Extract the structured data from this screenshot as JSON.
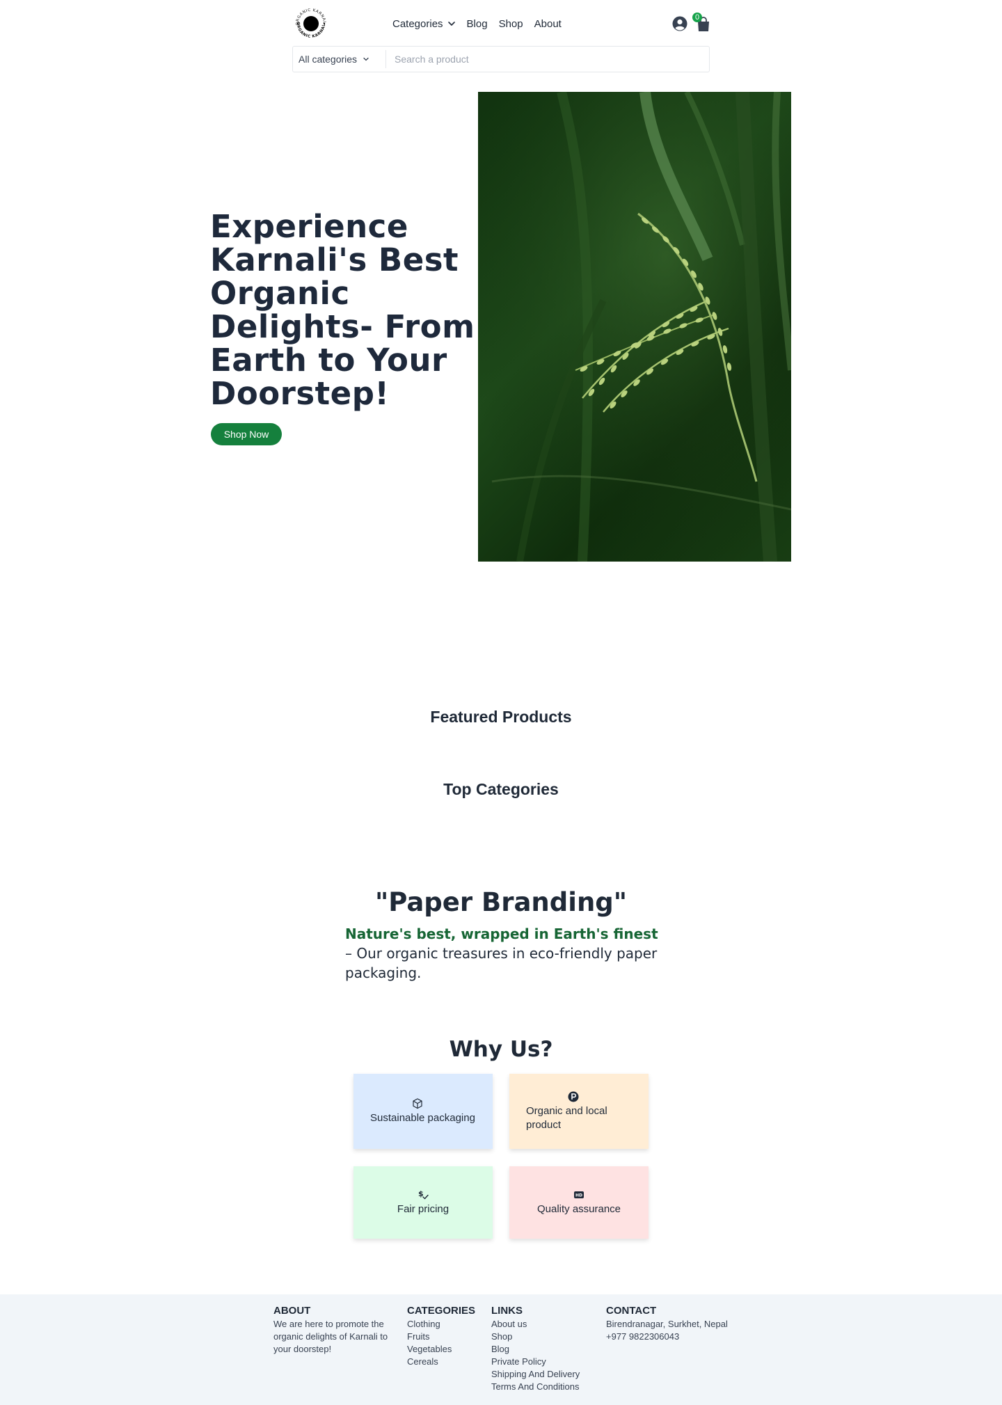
{
  "header": {
    "logo_top_text": "ORGANIC KARNALI",
    "logo_bottom_text": "ORGANIC KARNALI",
    "nav": {
      "categories": "Categories",
      "blog": "Blog",
      "shop": "Shop",
      "about": "About"
    },
    "cart_count": "0"
  },
  "search": {
    "category_label": "All categories",
    "placeholder": "Search a product",
    "value": ""
  },
  "hero": {
    "title": "Experience Karnali's Best Organic Delights- From Earth to Your Doorstep!",
    "button": "Shop Now",
    "image": "rice-plant-photo"
  },
  "sections": {
    "featured": "Featured Products",
    "top_categories": "Top Categories"
  },
  "paper": {
    "title": "\"Paper Branding\"",
    "highlight": "Nature's best, wrapped in Earth's finest",
    "text": " – Our organic treasures in eco-friendly paper packaging."
  },
  "why": {
    "title": "Why Us?",
    "cards": [
      {
        "label": "Sustainable packaging",
        "icon": "cube-icon",
        "color": "#dbeafe"
      },
      {
        "label": "Organic and local product",
        "icon": "product-badge-icon",
        "color": "#ffedd5"
      },
      {
        "label": "Fair pricing",
        "icon": "price-check-icon",
        "color": "#dcfce7"
      },
      {
        "label": "Quality assurance",
        "icon": "hd-badge-icon",
        "color": "#fee2e2"
      }
    ]
  },
  "footer": {
    "about": {
      "heading": "ABOUT",
      "text": "We are here to promote the organic delights of Karnali to your doorstep!"
    },
    "categories": {
      "heading": "CATEGORIES",
      "items": [
        "Clothing",
        "Fruits",
        "Vegetables",
        "Cereals"
      ]
    },
    "links": {
      "heading": "LINKS",
      "items": [
        "About us",
        "Shop",
        "Blog",
        "Private Policy",
        "Shipping And Delivery",
        "Terms And Conditions"
      ]
    },
    "contact": {
      "heading": "CONTACT",
      "address": "Birendranagar, Surkhet, Nepal",
      "phone": "+977 9822306043"
    }
  },
  "colors": {
    "accent": "#15803d",
    "highlight": "#166534",
    "text": "#1f2937",
    "footer_bg": "#f1f5f9"
  }
}
